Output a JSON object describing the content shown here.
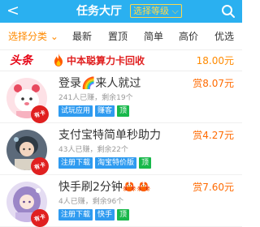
{
  "header": {
    "back_glyph": "<",
    "title": "任务大厅",
    "level_select": "选择等级",
    "level_chevron": "⌵"
  },
  "filters": [
    {
      "label": "选择分类",
      "chevron": "⌄",
      "active": true
    },
    {
      "label": "最新"
    },
    {
      "label": "置顶"
    },
    {
      "label": "简单"
    },
    {
      "label": "高价"
    },
    {
      "label": "优选"
    }
  ],
  "headline": {
    "badge": "头条",
    "text": "中本聪算力卡回收",
    "price": "18.00元"
  },
  "tasks": [
    {
      "title": "登录🌈来人就过",
      "meta": "241人已赚，剩余19个",
      "tags": [
        "试玩应用",
        "赚客",
        "顶"
      ],
      "reward": "赏8.07元",
      "stamp": "有卡"
    },
    {
      "title": "支付宝特简单秒助力",
      "meta": "43人已赚，剩余22个",
      "tags": [
        "注册下载",
        "淘宝特价版",
        "顶"
      ],
      "reward": "赏4.27元",
      "stamp": "有卡"
    },
    {
      "title": "快手刷2分钟🦀🦀",
      "meta": "4人已赚，剩余96个",
      "tags": [
        "注册下载",
        "快手",
        "顶"
      ],
      "reward": "赏7.60元",
      "stamp": "有卡"
    }
  ],
  "colors": {
    "header_bg": "#2ab0f0",
    "accent_orange": "#ff8a00",
    "headline_red": "#e02020",
    "tag_blue": "#2f9bf0",
    "tag_green": "#18b84b"
  },
  "icons": [
    "back-icon",
    "search-icon",
    "fire-icon",
    "chevron-down-icon"
  ]
}
